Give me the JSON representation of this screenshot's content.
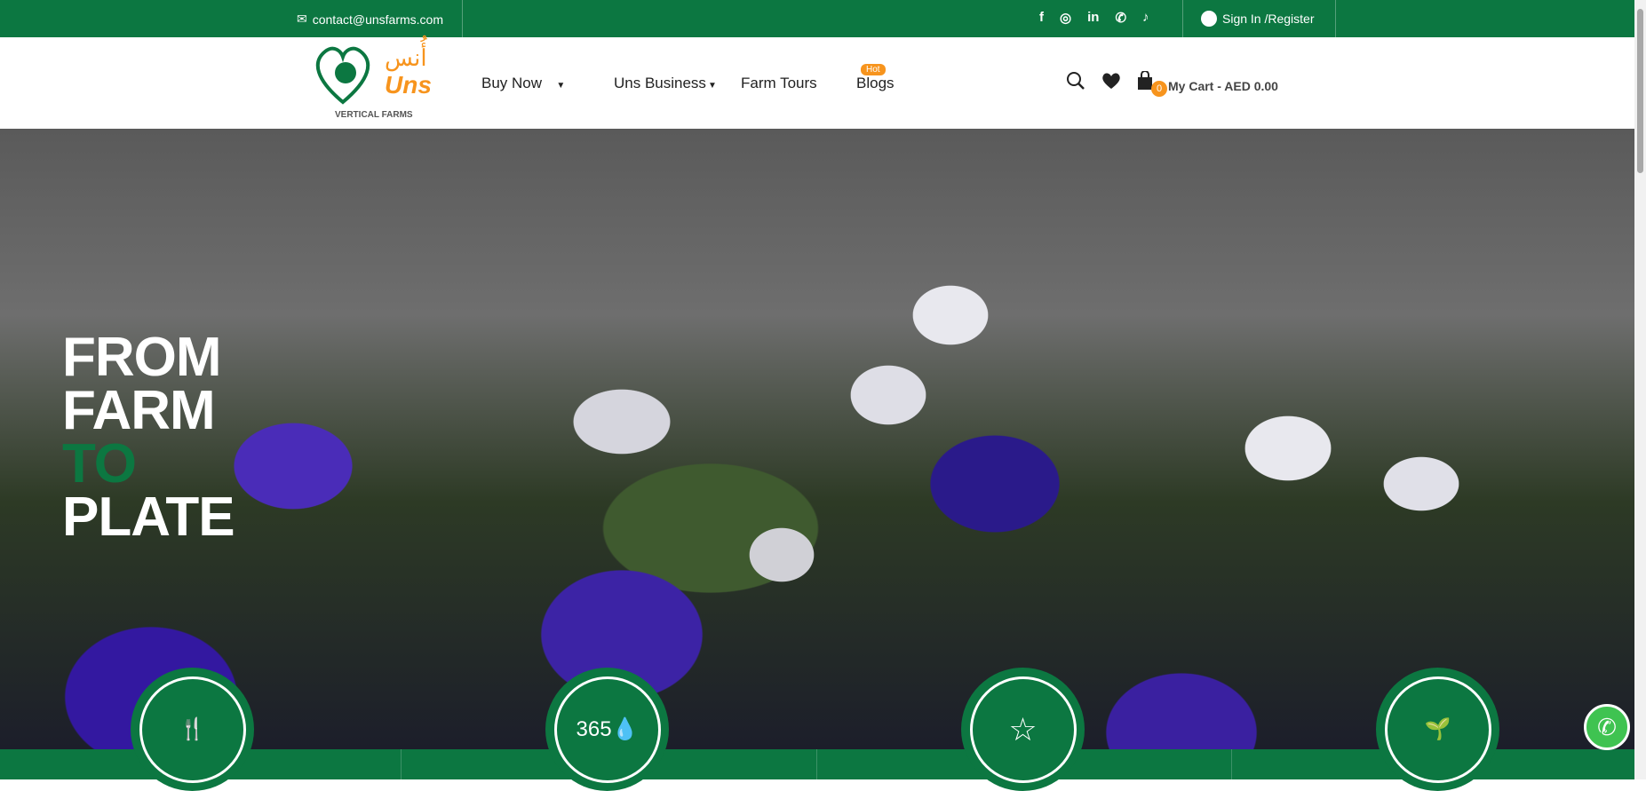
{
  "topbar": {
    "email": "contact@unsfarms.com",
    "signin": "Sign In /Register",
    "social": [
      "facebook",
      "instagram",
      "linkedin",
      "whatsapp",
      "tiktok"
    ]
  },
  "logo": {
    "arabic": "أُنس",
    "name": "Uns",
    "tagline": "VERTICAL FARMS"
  },
  "nav": {
    "buy_now": "Buy Now",
    "uns_business": "Uns Business",
    "farm_tours": "Farm Tours",
    "blogs": "Blogs",
    "hot": "Hot"
  },
  "cart": {
    "count": "0",
    "label": "My Cart - AED 0.00"
  },
  "hero": {
    "line1": "FROM",
    "line2": "FARM",
    "line3": "TO",
    "line4": "PLATE"
  },
  "features": [
    {
      "icon": "dining-plant-icon"
    },
    {
      "icon": "365-water-icon",
      "text": "365"
    },
    {
      "icon": "star-burst-icon"
    },
    {
      "icon": "sprout-icon"
    }
  ],
  "colors": {
    "brand_green": "#0c7741",
    "accent_orange": "#f7941d"
  }
}
